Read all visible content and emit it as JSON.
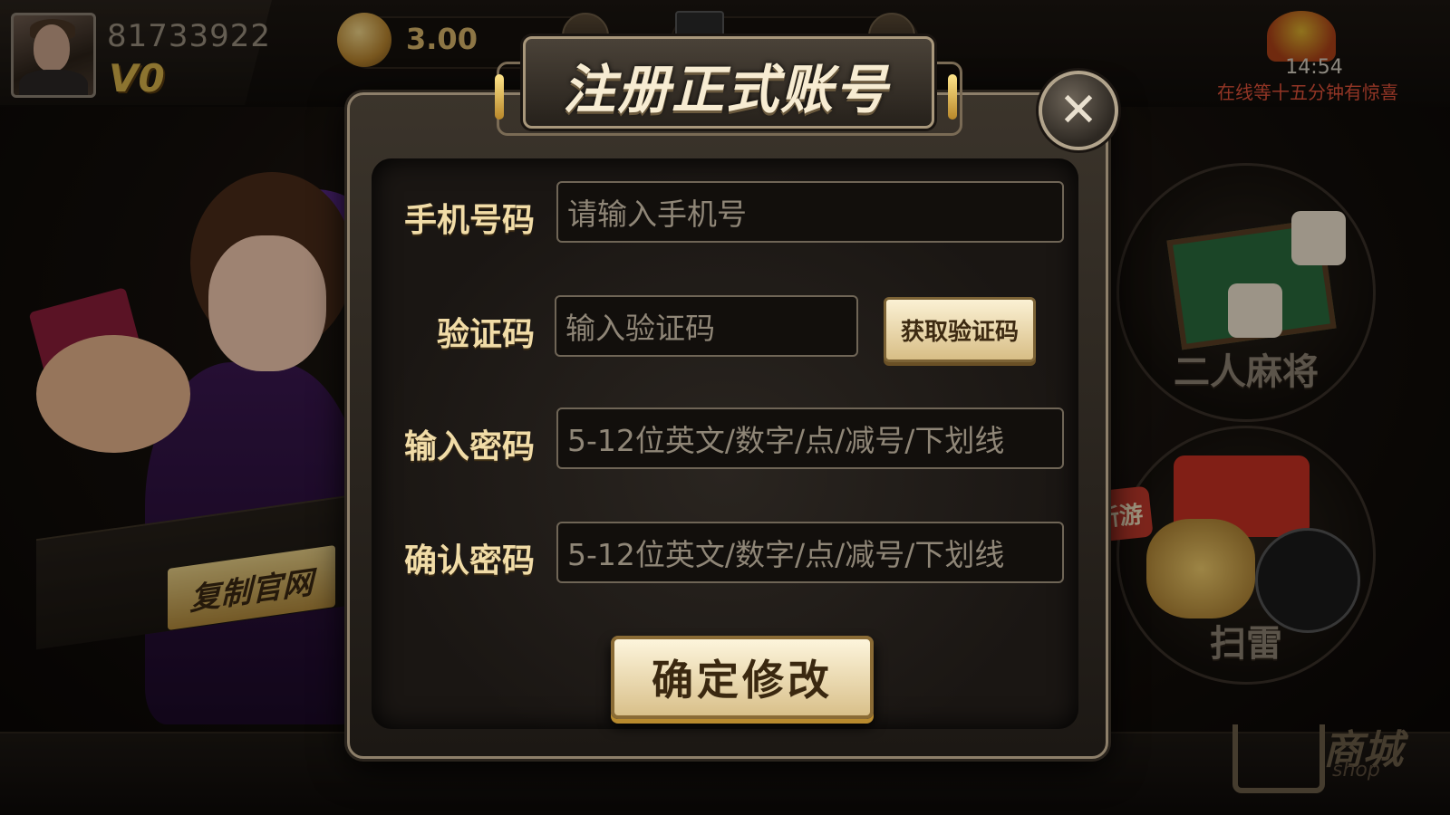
{
  "header": {
    "user_id": "81733922",
    "vip_level": "V0",
    "coin_amount": "3.00",
    "clock": "14:54",
    "promo_text": "在线等十五分钟有惊喜"
  },
  "sidebar": {
    "copy_site_label": "复制官网"
  },
  "games": [
    {
      "label": "二人麻将"
    },
    {
      "label": "扫雷",
      "badge": "新游"
    }
  ],
  "shop": {
    "label": "商城",
    "sub_label": "shop"
  },
  "dialog": {
    "title": "注册正式账号",
    "fields": [
      {
        "label": "手机号码",
        "placeholder": "请输入手机号"
      },
      {
        "label": "验证码",
        "placeholder": "输入验证码"
      },
      {
        "label": "输入密码",
        "placeholder": "5-12位英文/数字/点/减号/下划线"
      },
      {
        "label": "确认密码",
        "placeholder": "5-12位英文/数字/点/减号/下划线"
      }
    ],
    "get_code_label": "获取验证码",
    "confirm_label": "确定修改",
    "close_symbol": "✕"
  },
  "colors": {
    "accent_gold": "#f1dca7",
    "promo_red": "#e0523a",
    "vip_gold": "#d8b24a"
  }
}
